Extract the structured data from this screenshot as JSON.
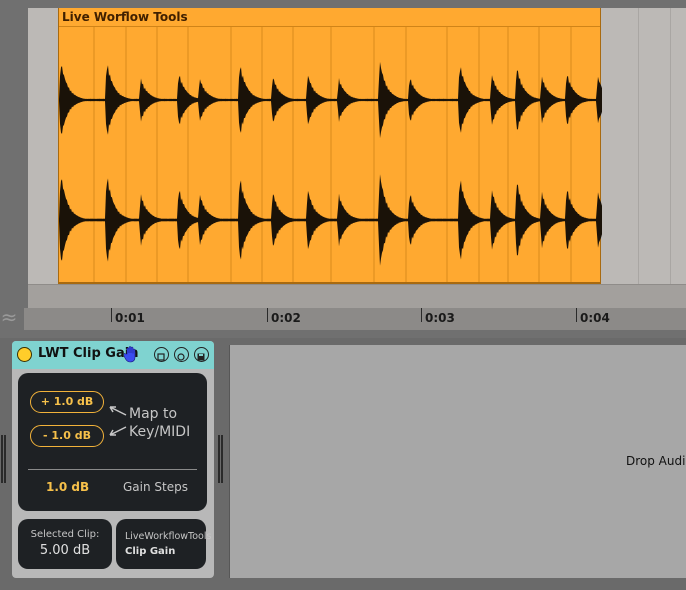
{
  "arrangement": {
    "clip_name": "Live Worflow Tools",
    "timeline_labels": [
      "0:01",
      "0:02",
      "0:03",
      "0:04"
    ]
  },
  "device": {
    "title": "LWT Clip Gain",
    "header_icons": [
      "hand-icon",
      "fold-icon",
      "hotswap-icon",
      "save-icon"
    ],
    "increase_label": "+ 1.0 dB",
    "decrease_label": "- 1.0 dB",
    "map_text_line1": "Map to",
    "map_text_line2": "Key/MIDI",
    "gain_step_value": "1.0 dB",
    "gain_step_label": "Gain Steps",
    "selected_clip_label": "Selected Clip:",
    "selected_clip_value": "5.00 dB",
    "brand_line1": "LiveWorkflowTools",
    "brand_line2": "Clip Gain"
  },
  "drop_area": {
    "text": "Drop Audi"
  },
  "colors": {
    "clip": "#ffa930",
    "device_header": "#7fd3d0",
    "accent": "#f6c04a",
    "panel": "#1e2124"
  }
}
